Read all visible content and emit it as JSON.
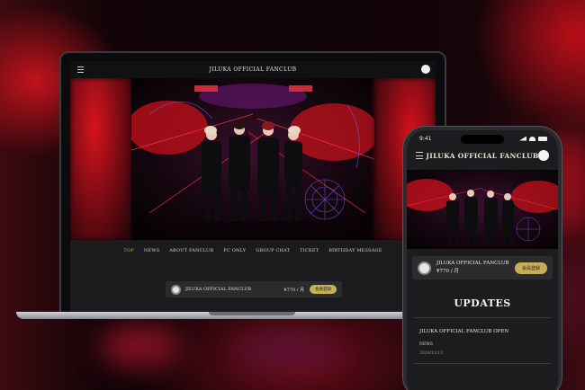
{
  "laptop": {
    "header_title": "JILUKA OFFICIAL FANCLUB",
    "nav": [
      "TOP",
      "NEWS",
      "ABOUT FANCLUB",
      "FC ONLY",
      "GROUP CHAT",
      "TICKET",
      "BIRTHDAY MESSAGE"
    ],
    "nav_active": "TOP",
    "member_bar": {
      "name": "JILUKA OFFICIAL FANCLUB",
      "price": "¥770 / 月",
      "join_label": "会員登録"
    }
  },
  "phone": {
    "status_time": "9:41",
    "header_title": "JILUKA OFFICIAL FANCLUB",
    "member_card": {
      "name": "JILUKA OFFICIAL FANCLUB",
      "price": "¥770 / 月",
      "join_label": "会員登録"
    },
    "updates_heading": "UPDATES",
    "news": {
      "title": "JILUKA OFFICIAL FANCLUB OPEN",
      "category": "NEWS",
      "date": "2024/11/13"
    }
  },
  "colors": {
    "accent_gold": "#c8ad57",
    "stage_red": "#d9141e",
    "background": "#1b1b1d"
  },
  "icons": [
    "hamburger-menu-icon",
    "avatar-icon",
    "fanclub-logo-icon",
    "signal-icon",
    "wifi-icon",
    "battery-icon"
  ]
}
